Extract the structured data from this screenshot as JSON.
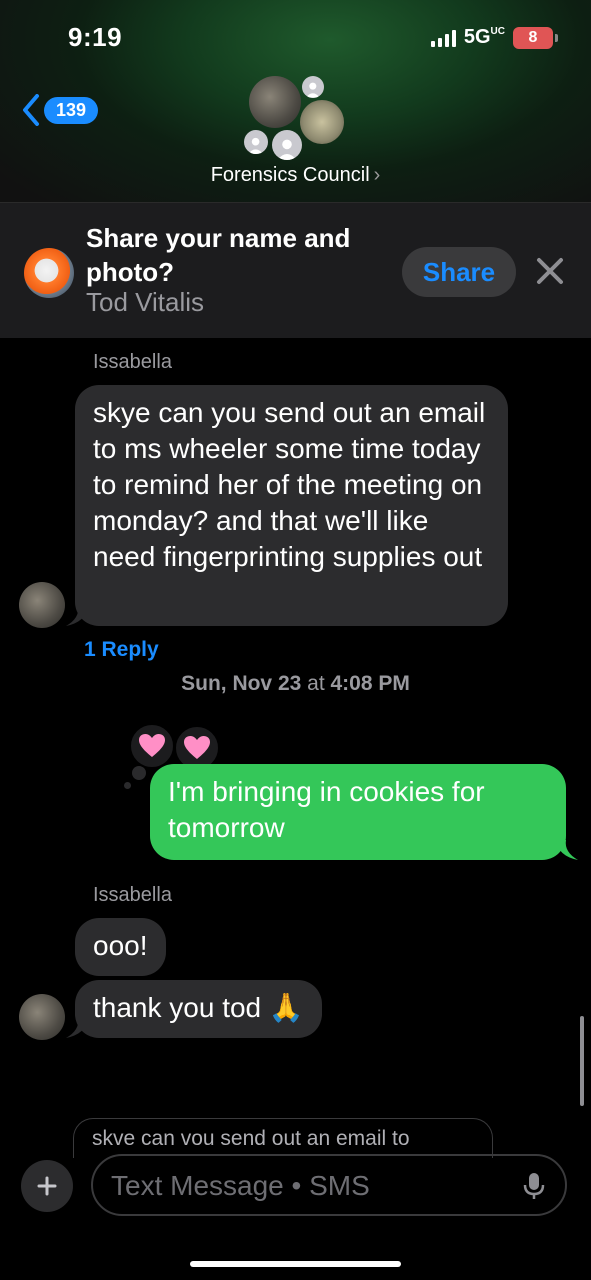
{
  "status_bar": {
    "time": "9:19",
    "network": "5G",
    "network_suffix": "UC",
    "battery": "8"
  },
  "header": {
    "back_count": "139",
    "group_name": "Forensics Council",
    "chevron": "›"
  },
  "share_banner": {
    "title": "Share your name and photo?",
    "name": "Tod Vitalis",
    "share_label": "Share"
  },
  "messages": [
    {
      "sender": "Issabella",
      "text": "skye can you send out an email to ms wheeler some time today to remind her of the meeting on monday? and that we'll like need fingerprinting supplies out"
    },
    {
      "outgoing": true,
      "text": "I'm bringing in cookies for tomorrow",
      "tapbacks": [
        "heart-icon",
        "heart-icon"
      ]
    },
    {
      "sender": "Issabella",
      "text": "ooo!"
    },
    {
      "text": "thank you tod 🙏"
    }
  ],
  "reply_link": "1 Reply",
  "timestamp": {
    "date": "Sun, Nov 23",
    "at": " at ",
    "time": "4:08 PM"
  },
  "reply_preview": "skve can vou send out an email to",
  "composer": {
    "placeholder": "Text Message • SMS"
  },
  "colors": {
    "accent": "#1a8cff",
    "outgoing_bubble": "#34c759",
    "incoming_bubble": "#2c2c2e"
  }
}
